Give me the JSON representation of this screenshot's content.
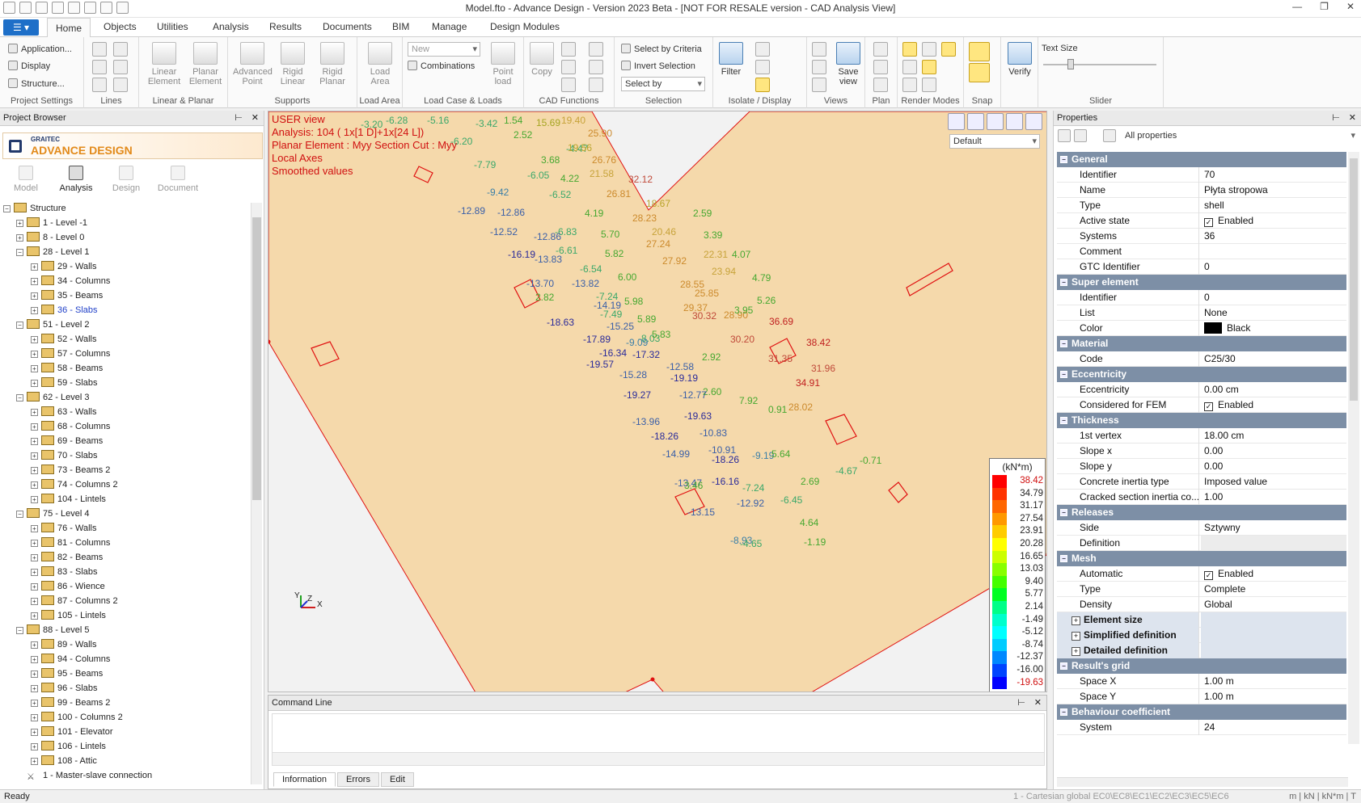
{
  "window": {
    "title": "Model.fto - Advance Design - Version 2023 Beta - [NOT FOR RESALE version - CAD Analysis View]"
  },
  "ribbon": {
    "tabs": [
      "Home",
      "Objects",
      "Utilities",
      "Analysis",
      "Results",
      "Documents",
      "BIM",
      "Manage",
      "Design Modules"
    ],
    "project_settings": {
      "items": [
        "Application...",
        "Display",
        "Structure..."
      ],
      "label": "Project Settings"
    },
    "lines": {
      "label": "Lines"
    },
    "linear_planar": {
      "buttons": [
        "Linear Element",
        "Planar Element"
      ],
      "label": "Linear & Planar"
    },
    "supports": {
      "buttons": [
        "Advanced Point",
        "Rigid Linear",
        "Rigid Planar"
      ],
      "label": "Supports"
    },
    "load_area": {
      "button": "Load Area",
      "label": "Load Area"
    },
    "load_case": {
      "new_value": "New",
      "combinations": "Combinations",
      "point_load": "Point load",
      "label": "Load Case & Loads"
    },
    "cad": {
      "copy": "Copy",
      "label": "CAD Functions"
    },
    "selection": {
      "criteria": "Select by Criteria",
      "invert": "Invert Selection",
      "select_by": "Select by",
      "label": "Selection"
    },
    "isolate": {
      "filter": "Filter",
      "label": "Isolate / Display"
    },
    "views": {
      "save_view": "Save view",
      "label": "Views"
    },
    "plan": {
      "label": "Plan"
    },
    "render": {
      "label": "Render Modes"
    },
    "snap": {
      "label": "Snap"
    },
    "verify": {
      "button": "Verify"
    },
    "slider": {
      "text_size": "Text Size",
      "label": "Slider"
    }
  },
  "browser": {
    "title": "Project Browser",
    "brand_top": "GRAITEC",
    "brand_name": "ADVANCE DESIGN",
    "mode_tabs": [
      "Model",
      "Analysis",
      "Design",
      "Document"
    ],
    "tree": [
      "Structure",
      "1 - Level -1",
      "8 - Level 0",
      "28 - Level 1",
      "29 - Walls",
      "34 - Columns",
      "35 - Beams",
      "36 - Slabs",
      "51 - Level 2",
      "52 - Walls",
      "57 - Columns",
      "58 - Beams",
      "59 - Slabs",
      "62 - Level 3",
      "63 - Walls",
      "68 - Columns",
      "69 - Beams",
      "70 - Slabs",
      "73 - Beams 2",
      "74 - Columns 2",
      "104 - Lintels",
      "75 - Level 4",
      "76 - Walls",
      "81 - Columns",
      "82 - Beams",
      "83 - Slabs",
      "86 - Wience",
      "87 - Columns 2",
      "105 - Lintels",
      "88 - Level 5",
      "89 - Walls",
      "94 - Columns",
      "95 - Beams",
      "96 - Slabs",
      "99 - Beams 2",
      "100 - Columns 2",
      "101 - Elevator",
      "106 - Lintels",
      "108 - Attic",
      "1 - Master-slave connection"
    ]
  },
  "view": {
    "overlay": [
      "USER view",
      "Analysis: 104  ( 1x[1 D]+1x[24 L])",
      "Planar Element : Myy Section Cut : Myy",
      "Local Axes",
      "Smoothed values"
    ],
    "combo_value": "Default",
    "axes": {
      "x": "X",
      "y": "Y",
      "z": "Z"
    }
  },
  "legend": {
    "unit": "(kN*m)",
    "values": [
      "38.42",
      "34.79",
      "31.17",
      "27.54",
      "23.91",
      "20.28",
      "16.65",
      "13.03",
      "9.40",
      "5.77",
      "2.14",
      "-1.49",
      "-5.12",
      "-8.74",
      "-12.37",
      "-16.00",
      "-19.63"
    ],
    "colors": [
      "#ff0000",
      "#ff3300",
      "#ff6600",
      "#ff9900",
      "#ffcc00",
      "#ffff00",
      "#ccff00",
      "#88ff00",
      "#44ff00",
      "#00ff22",
      "#00ff88",
      "#00ffcc",
      "#00ffff",
      "#00ccff",
      "#0088ff",
      "#0044ff",
      "#0000ff"
    ]
  },
  "command_line": {
    "title": "Command Line",
    "tabs": [
      "Information",
      "Errors",
      "Edit"
    ]
  },
  "properties": {
    "title": "Properties",
    "filter": "All properties",
    "groups": [
      {
        "name": "General",
        "rows": [
          [
            "Identifier",
            "70"
          ],
          [
            "Name",
            "Płyta stropowa"
          ],
          [
            "Type",
            "shell"
          ],
          [
            "Active state",
            "Enabled"
          ],
          [
            "Systems",
            "36"
          ],
          [
            "Comment",
            ""
          ],
          [
            "GTC Identifier",
            "0"
          ]
        ]
      },
      {
        "name": "Super element",
        "rows": [
          [
            "Identifier",
            "0"
          ],
          [
            "List",
            "None"
          ],
          [
            "Color",
            "Black"
          ]
        ]
      },
      {
        "name": "Material",
        "rows": [
          [
            "Code",
            "C25/30"
          ]
        ]
      },
      {
        "name": "Eccentricity",
        "rows": [
          [
            "Eccentricity",
            "0.00 cm"
          ],
          [
            "Considered for FEM",
            "Enabled"
          ]
        ]
      },
      {
        "name": "Thickness",
        "rows": [
          [
            "1st vertex",
            "18.00 cm"
          ],
          [
            "Slope x",
            "0.00"
          ],
          [
            "Slope y",
            "0.00"
          ],
          [
            "Concrete inertia type",
            "Imposed value"
          ],
          [
            "Cracked section inertia co...",
            "1.00"
          ]
        ]
      },
      {
        "name": "Releases",
        "rows": [
          [
            "Side",
            "Sztywny"
          ],
          [
            "Definition",
            ""
          ]
        ]
      },
      {
        "name": "Mesh",
        "rows": [
          [
            "Automatic",
            "Enabled"
          ],
          [
            "Type",
            "Complete"
          ],
          [
            "Density",
            "Global"
          ]
        ],
        "subs": [
          "Element size",
          "Simplified definition",
          "Detailed definition"
        ]
      },
      {
        "name": "Result's grid",
        "rows": [
          [
            "Space X",
            "1.00 m"
          ],
          [
            "Space Y",
            "1.00 m"
          ]
        ]
      },
      {
        "name": "Behaviour coefficient",
        "rows": [
          [
            "System",
            "24"
          ]
        ]
      }
    ]
  },
  "status": {
    "ready": "Ready",
    "system": "1 - Cartesian global   EC0\\EC8\\EC1\\EC2\\EC3\\EC5\\EC6",
    "units": "m | kN | kN*m | T"
  },
  "contour_labels": [
    {
      "t": "-3.20",
      "c": "#3aa86a"
    },
    {
      "t": "-6.28",
      "c": "#3aa86a"
    },
    {
      "t": "-5.16",
      "c": "#3aa86a"
    },
    {
      "t": "-3.42",
      "c": "#3aa86a"
    },
    {
      "t": "1.54",
      "c": "#46a830"
    },
    {
      "t": "15.69",
      "c": "#a5a521"
    },
    {
      "t": "19.40",
      "c": "#c7a33a"
    },
    {
      "t": "2.52",
      "c": "#46a830"
    },
    {
      "t": "-4.47",
      "c": "#3aa86a"
    },
    {
      "t": "19.56",
      "c": "#b9a42a"
    },
    {
      "t": "25.90",
      "c": "#cc8a2c"
    },
    {
      "t": "3.68",
      "c": "#46a830"
    },
    {
      "t": "-6.05",
      "c": "#3aa86a"
    },
    {
      "t": "-6.20",
      "c": "#3aa86a"
    },
    {
      "t": "-7.79",
      "c": "#3aa86a"
    },
    {
      "t": "26.76",
      "c": "#cc8a2c"
    },
    {
      "t": "21.58",
      "c": "#c7a33a"
    },
    {
      "t": "4.22",
      "c": "#46a830"
    },
    {
      "t": "32.12",
      "c": "#c04a3a"
    },
    {
      "t": "-9.42",
      "c": "#3a7fa8"
    },
    {
      "t": "-6.52",
      "c": "#3aa86a"
    },
    {
      "t": "26.81",
      "c": "#cc8a2c"
    },
    {
      "t": "18.67",
      "c": "#b9a42a"
    },
    {
      "t": "-12.89",
      "c": "#3a5fa8"
    },
    {
      "t": "-12.86",
      "c": "#3a5fa8"
    },
    {
      "t": "4.19",
      "c": "#46a830"
    },
    {
      "t": "28.23",
      "c": "#cc8a2c"
    },
    {
      "t": "-6.83",
      "c": "#3aa86a"
    },
    {
      "t": "20.46",
      "c": "#c7a33a"
    },
    {
      "t": "2.59",
      "c": "#46a830"
    },
    {
      "t": "-12.52",
      "c": "#3a5fa8"
    },
    {
      "t": "-12.86",
      "c": "#3a5fa8"
    },
    {
      "t": "5.70",
      "c": "#46a830"
    },
    {
      "t": "27.24",
      "c": "#cc8a2c"
    },
    {
      "t": "3.39",
      "c": "#46a830"
    },
    {
      "t": "-16.19",
      "c": "#2a2a9a"
    },
    {
      "t": "-6.61",
      "c": "#3aa86a"
    },
    {
      "t": "22.31",
      "c": "#c7a33a"
    },
    {
      "t": "-13.83",
      "c": "#3a5fa8"
    },
    {
      "t": "5.82",
      "c": "#46a830"
    },
    {
      "t": "27.92",
      "c": "#cc8a2c"
    },
    {
      "t": "4.07",
      "c": "#46a830"
    },
    {
      "t": "-6.54",
      "c": "#3aa86a"
    },
    {
      "t": "23.94",
      "c": "#c7a33a"
    },
    {
      "t": "-13.70",
      "c": "#3a5fa8"
    },
    {
      "t": "-13.82",
      "c": "#3a5fa8"
    },
    {
      "t": "6.00",
      "c": "#46a830"
    },
    {
      "t": "28.55",
      "c": "#cc8a2c"
    },
    {
      "t": "4.79",
      "c": "#46a830"
    },
    {
      "t": "-7.24",
      "c": "#3aa86a"
    },
    {
      "t": "25.85",
      "c": "#cc8a2c"
    },
    {
      "t": "2.82",
      "c": "#46a830"
    },
    {
      "t": "-14.19",
      "c": "#3a5fa8"
    },
    {
      "t": "5.98",
      "c": "#46a830"
    },
    {
      "t": "29.37",
      "c": "#cc8a2c"
    },
    {
      "t": "5.26",
      "c": "#46a830"
    },
    {
      "t": "-18.63",
      "c": "#2a2a9a"
    },
    {
      "t": "-7.49",
      "c": "#3aa86a"
    },
    {
      "t": "28.90",
      "c": "#cc8a2c"
    },
    {
      "t": "-15.25",
      "c": "#3a5fa8"
    },
    {
      "t": "5.89",
      "c": "#46a830"
    },
    {
      "t": "30.32",
      "c": "#c04a3a"
    },
    {
      "t": "3.95",
      "c": "#46a830"
    },
    {
      "t": "-8.03",
      "c": "#3aa86a"
    },
    {
      "t": "-17.89",
      "c": "#2a2a9a"
    },
    {
      "t": "5.83",
      "c": "#46a830"
    },
    {
      "t": "36.69",
      "c": "#c02020"
    },
    {
      "t": "-16.34",
      "c": "#2a2a9a"
    },
    {
      "t": "-9.09",
      "c": "#3a7fa8"
    },
    {
      "t": "30.20",
      "c": "#c04a3a"
    },
    {
      "t": "38.42",
      "c": "#c02020"
    },
    {
      "t": "-19.57",
      "c": "#2a2a9a"
    },
    {
      "t": "-17.32",
      "c": "#2a2a9a"
    },
    {
      "t": "2.92",
      "c": "#46a830"
    },
    {
      "t": "31.35",
      "c": "#c04a3a"
    },
    {
      "t": "-12.58",
      "c": "#3a5fa8"
    },
    {
      "t": "31.96",
      "c": "#c04a3a"
    },
    {
      "t": "-15.28",
      "c": "#3a5fa8"
    },
    {
      "t": "-19.19",
      "c": "#2a2a9a"
    },
    {
      "t": "2.60",
      "c": "#46a830"
    },
    {
      "t": "34.91",
      "c": "#c02020"
    },
    {
      "t": "-19.27",
      "c": "#2a2a9a"
    },
    {
      "t": "-12.77",
      "c": "#3a5fa8"
    },
    {
      "t": "7.92",
      "c": "#46a830"
    },
    {
      "t": "28.02",
      "c": "#cc8a2c"
    },
    {
      "t": "-19.63",
      "c": "#2a2a9a"
    },
    {
      "t": "-13.96",
      "c": "#3a5fa8"
    },
    {
      "t": "-10.83",
      "c": "#3a5fa8"
    },
    {
      "t": "0.91",
      "c": "#46a830"
    },
    {
      "t": "-18.26",
      "c": "#2a2a9a"
    },
    {
      "t": "-10.91",
      "c": "#3a5fa8"
    },
    {
      "t": "-14.99",
      "c": "#3a5fa8"
    },
    {
      "t": "-18.26",
      "c": "#2a2a9a"
    },
    {
      "t": "-9.19",
      "c": "#3a7fa8"
    },
    {
      "t": "5.64",
      "c": "#46a830"
    },
    {
      "t": "-13.47",
      "c": "#3a5fa8"
    },
    {
      "t": "-16.16",
      "c": "#2a2a9a"
    },
    {
      "t": "2.69",
      "c": "#46a830"
    },
    {
      "t": "3.46",
      "c": "#46a830"
    },
    {
      "t": "-7.24",
      "c": "#3aa86a"
    },
    {
      "t": "-12.92",
      "c": "#3a5fa8"
    },
    {
      "t": "-13.15",
      "c": "#3a5fa8"
    },
    {
      "t": "-4.67",
      "c": "#3aa86a"
    },
    {
      "t": "-6.45",
      "c": "#3aa86a"
    },
    {
      "t": "-8.93",
      "c": "#3a7fa8"
    },
    {
      "t": "-0.71",
      "c": "#46a830"
    },
    {
      "t": "-1.19",
      "c": "#46a830"
    },
    {
      "t": "-4.65",
      "c": "#3aa86a"
    },
    {
      "t": "4.64",
      "c": "#46a830"
    }
  ]
}
